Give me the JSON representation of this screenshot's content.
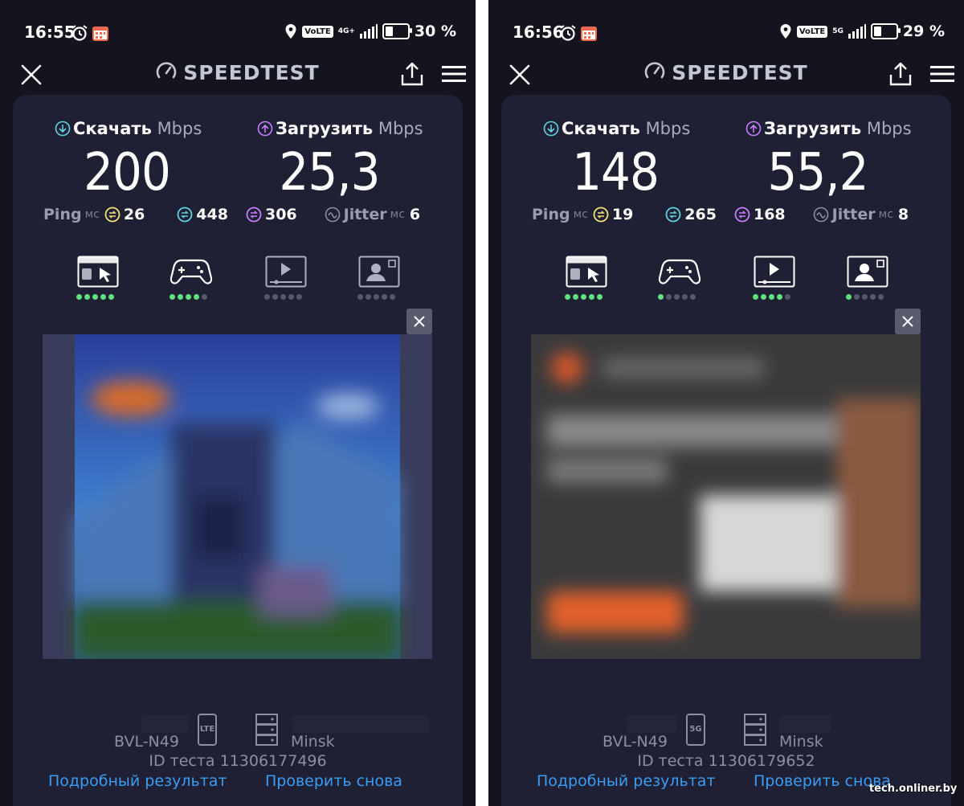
{
  "screens": [
    {
      "status": {
        "time": "16:55",
        "volte": "VoLTE",
        "network": "4G+",
        "battery_pct": "30 %",
        "battery_level": 0.3
      },
      "app_title": "SPEEDTEST",
      "download": {
        "label": "Скачать",
        "unit": "Mbps",
        "value": "200"
      },
      "upload": {
        "label": "Загрузить",
        "unit": "Mbps",
        "value": "25,3"
      },
      "ping": {
        "label": "Ping",
        "unit": "мс",
        "idle": "26",
        "down": "448",
        "up": "306"
      },
      "jitter": {
        "label": "Jitter",
        "unit": "мс",
        "value": "6"
      },
      "categories": [
        {
          "icon": "web-browsing-icon",
          "rating": 5
        },
        {
          "icon": "gaming-icon",
          "rating": 4
        },
        {
          "icon": "video-streaming-icon",
          "rating": 0
        },
        {
          "icon": "video-call-icon",
          "rating": 0
        }
      ],
      "device": "BVL-N49",
      "tech_badge": "LTE",
      "server": "Minsk",
      "test_id": "ID теста 11306177496",
      "link_details": "Подробный результат",
      "link_retest": "Проверить снова"
    },
    {
      "status": {
        "time": "16:56",
        "volte": "VoLTE",
        "network": "5G",
        "battery_pct": "29 %",
        "battery_level": 0.29
      },
      "app_title": "SPEEDTEST",
      "download": {
        "label": "Скачать",
        "unit": "Mbps",
        "value": "148"
      },
      "upload": {
        "label": "Загрузить",
        "unit": "Mbps",
        "value": "55,2"
      },
      "ping": {
        "label": "Ping",
        "unit": "мс",
        "idle": "19",
        "down": "265",
        "up": "168"
      },
      "jitter": {
        "label": "Jitter",
        "unit": "мс",
        "value": "8"
      },
      "categories": [
        {
          "icon": "web-browsing-icon",
          "rating": 5
        },
        {
          "icon": "gaming-icon",
          "rating": 1
        },
        {
          "icon": "video-streaming-icon",
          "rating": 4
        },
        {
          "icon": "video-call-icon",
          "rating": 1
        }
      ],
      "device": "BVL-N49",
      "tech_badge": "5G",
      "server": "Minsk",
      "test_id": "ID теста 11306179652",
      "link_details": "Подробный результат",
      "link_retest": "Проверить снова"
    }
  ],
  "watermark": "tech.onliner.by",
  "colors": {
    "background": "#14141f",
    "card": "#1f2033",
    "download": "#5fd3e0",
    "upload": "#c77dff",
    "idle": "#f2e27a",
    "link": "#3a9cf5",
    "dot_on": "#5ee07a"
  }
}
